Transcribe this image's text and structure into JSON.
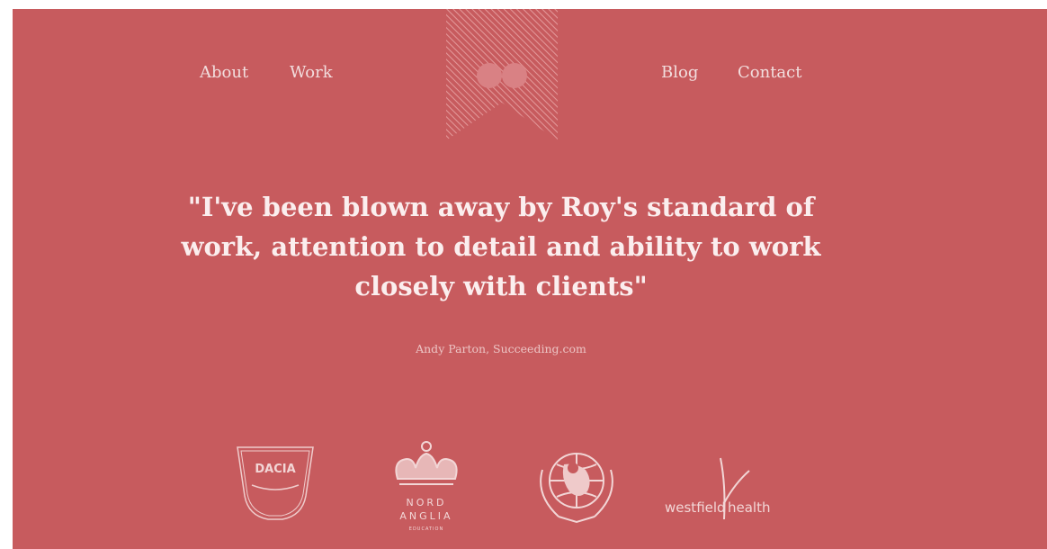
{
  "nav": {
    "left": [
      "About",
      "Work"
    ],
    "right": [
      "Blog",
      "Contact"
    ]
  },
  "logo": {
    "icon": "striped-ribbon-bookmark-icon"
  },
  "testimonial": {
    "quote": "\"I've been blown away by Roy's standard of work, attention to detail and ability to work closely with clients\"",
    "author": "Andy Parton, Succeeding.com"
  },
  "clients": [
    {
      "name": "dacia",
      "text": "DACIA"
    },
    {
      "name": "nord-anglia",
      "text": [
        "NORD",
        "ANGLIA",
        "EDUCATION"
      ]
    },
    {
      "name": "unicef",
      "icon": "unicef-emblem-icon"
    },
    {
      "name": "westfield-health",
      "text": [
        "westfield",
        "health"
      ]
    }
  ],
  "colors": {
    "background": "#c75b5e",
    "text": "#fbeeee",
    "muted_text": "#ecc4c4"
  }
}
